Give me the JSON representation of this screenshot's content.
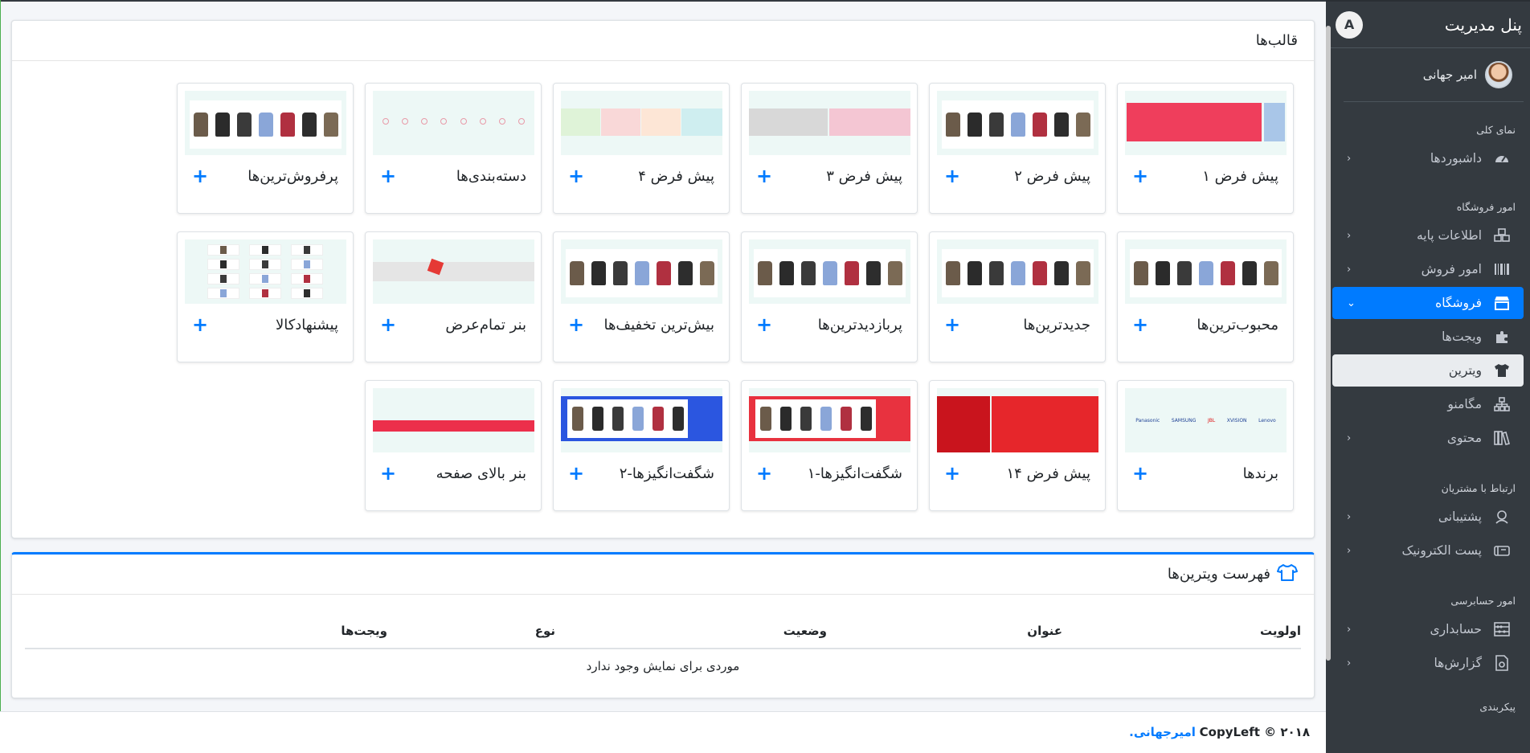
{
  "sidebar": {
    "title": "پنل مدیریت",
    "logo": "A",
    "user_name": "امیر جهانی",
    "sections": {
      "overview": "نمای کلی",
      "store_affairs": "امور فروشگاه",
      "customer_relations": "ارتباط با مشتریان",
      "accounting": "امور حسابرسی",
      "config": "پیکربندی"
    },
    "items": {
      "dashboards": "داشبوردها",
      "basic_info": "اطلاعات پایه",
      "sales": "امور فروش",
      "shop": "فروشگاه",
      "widgets": "ویجت‌ها",
      "showcase": "ویترین",
      "megamenu": "مگامنو",
      "content": "محتوی",
      "support": "پشتیبانی",
      "email": "پست الکترونیک",
      "accounting": "حسابداری",
      "reports": "گزارش‌ها"
    }
  },
  "templates": {
    "title": "قالب‌ها",
    "plus": "+",
    "items": [
      {
        "label": "پیش فرض ۱"
      },
      {
        "label": "پیش فرض ۲"
      },
      {
        "label": "پیش فرض ۳"
      },
      {
        "label": "پیش فرض ۴"
      },
      {
        "label": "دسته‌بندی‌ها"
      },
      {
        "label": "پرفروش‌ترین‌ها"
      },
      {
        "label": "محبوب‌ترین‌ها"
      },
      {
        "label": "جدیدترین‌ها"
      },
      {
        "label": "پربازدیدترین‌ها"
      },
      {
        "label": "بیش‌ترین تخفیف‌ها"
      },
      {
        "label": "بنر تمام‌عرض"
      },
      {
        "label": "پیشنهادکالا"
      },
      {
        "label": "برندها"
      },
      {
        "label": "پیش فرض ۱۴"
      },
      {
        "label": "شگفت‌انگیزها-۱"
      },
      {
        "label": "شگفت‌انگیزها-۲"
      },
      {
        "label": "بنر بالای صفحه"
      }
    ]
  },
  "showcase_list": {
    "title": "فهرست ویترین‌ها",
    "columns": [
      "اولویت",
      "عنوان",
      "وضعیت",
      "نوع",
      "ویجت‌ها"
    ],
    "empty_text": "موردی برای نمایش وجود ندارد"
  },
  "footer": {
    "prefix": "۲۰۱۸ © CopyLeft",
    "author": "امیرجهانی."
  },
  "colors": {
    "accent": "#007bff",
    "sidebar_bg": "#343a40"
  }
}
